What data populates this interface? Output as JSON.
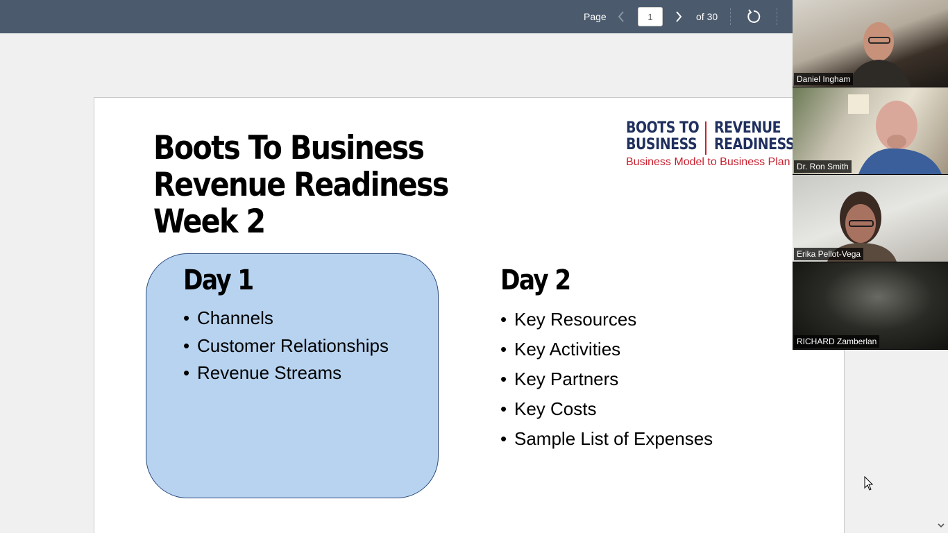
{
  "toolbar": {
    "page_label": "Page",
    "page_value": "1",
    "page_total": "of 30",
    "prev_icon": "chevron-left-icon",
    "next_icon": "chevron-right-icon",
    "rotate_icon": "rotate-icon"
  },
  "slide": {
    "title_lines": [
      "Boots To Business",
      "Revenue Readiness",
      "Week 2"
    ],
    "logo": {
      "left_lines": [
        "BOOTS TO",
        "BUSINESS"
      ],
      "right_lines": [
        "REVENUE",
        "READINESS"
      ],
      "subtitle": "Business Model to Business Plan"
    },
    "day1": {
      "heading": "Day 1",
      "items": [
        "Channels",
        "Customer Relationships",
        "Revenue Streams"
      ]
    },
    "day2": {
      "heading": "Day 2",
      "items": [
        "Key Resources",
        "Key Activities",
        "Key Partners",
        "Key Costs",
        "Sample List of Expenses"
      ]
    }
  },
  "participants": [
    {
      "name": "Daniel Ingham"
    },
    {
      "name": "Dr. Ron Smith"
    },
    {
      "name": "Erika Pellot-Vega"
    },
    {
      "name": "RICHARD Zamberlan"
    }
  ],
  "colors": {
    "toolbar_bg": "#4b5a6c",
    "day1_fill": "#b7d3f0",
    "logo_navy": "#1f2f5e",
    "logo_red": "#c8202f"
  }
}
